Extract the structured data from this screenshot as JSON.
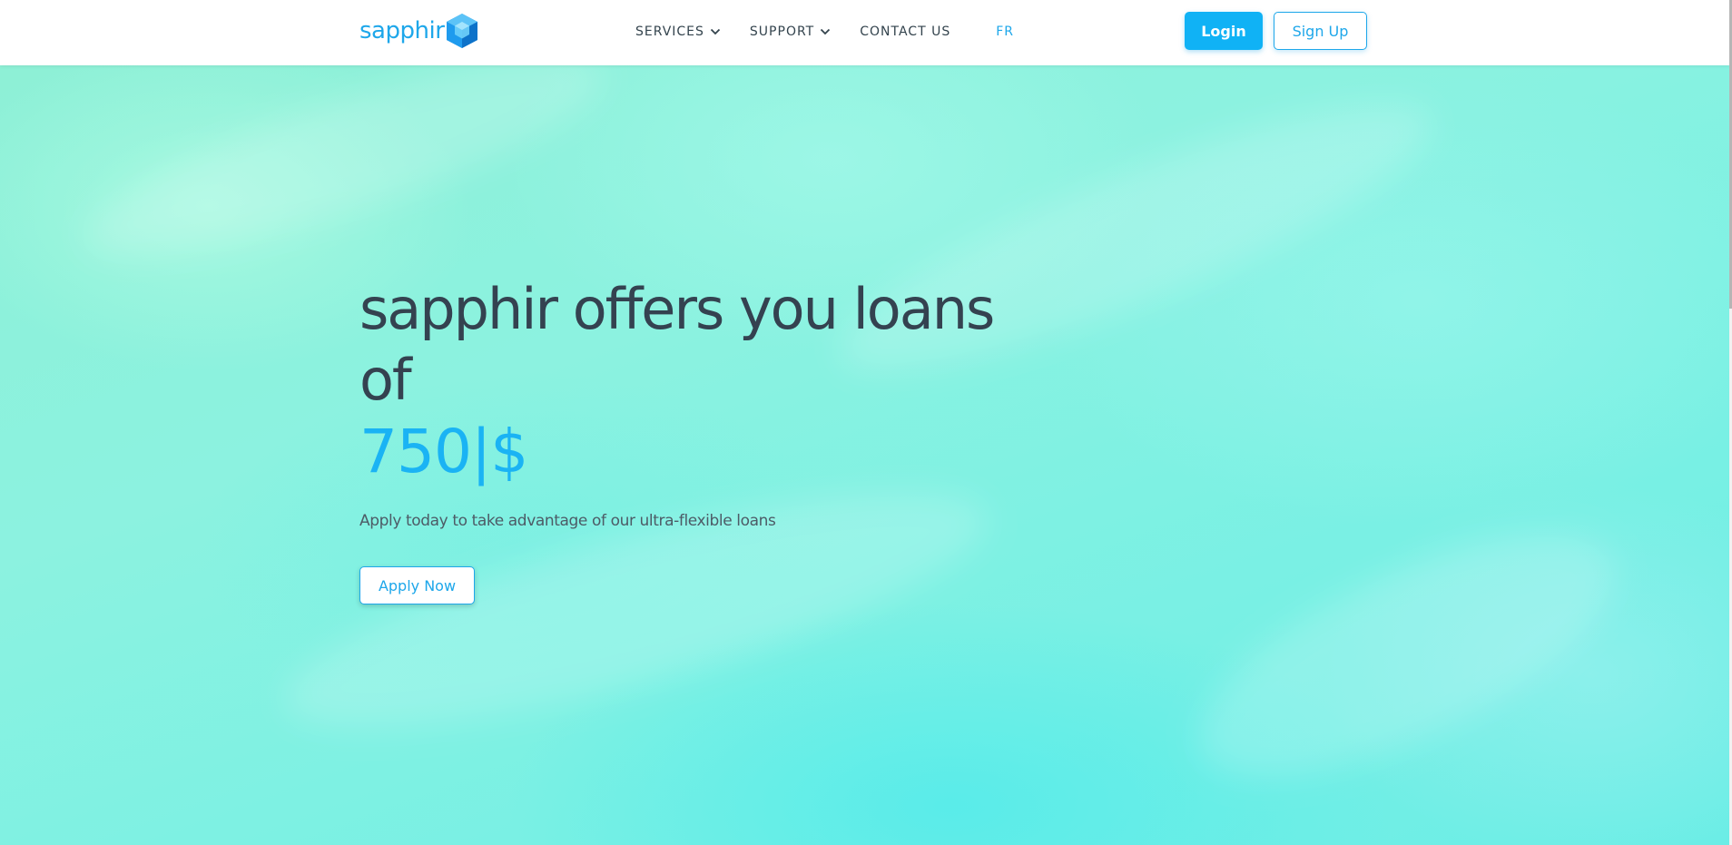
{
  "header": {
    "logo_text": "sapphir",
    "logo_icon": "hexagon-cube-icon",
    "nav": [
      {
        "label": "SERVICES",
        "has_dropdown": true
      },
      {
        "label": "SUPPORT",
        "has_dropdown": true
      },
      {
        "label": "CONTACT US",
        "has_dropdown": false
      }
    ],
    "language": "FR",
    "login_label": "Login",
    "signup_label": "Sign Up"
  },
  "hero": {
    "headline": "sapphir offers you loans of",
    "amount": "750|$",
    "subtitle": "Apply today to take advantage of our ultra-flexible loans",
    "apply_label": "Apply Now"
  },
  "colors": {
    "accent": "#10b2f5",
    "brand": "#1ea7ea",
    "headline": "#344250",
    "hero_bg": "#7ef1e3"
  }
}
